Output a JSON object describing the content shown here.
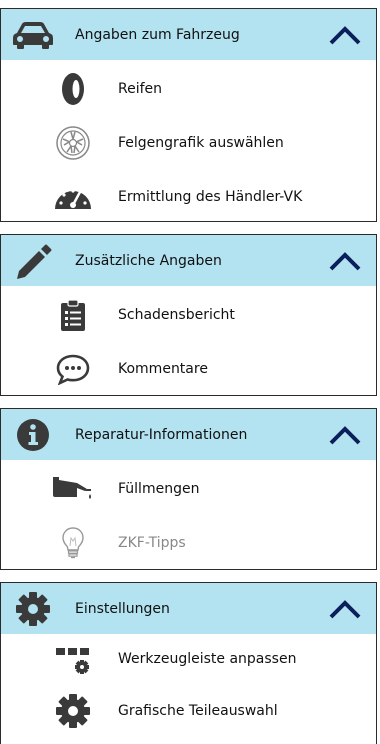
{
  "sections": [
    {
      "title": "Angaben zum Fahrzeug",
      "icon": "car-icon",
      "items": [
        {
          "label": "Reifen",
          "icon": "tire-icon"
        },
        {
          "label": "Felgengrafik auswählen",
          "icon": "rim-icon"
        },
        {
          "label": "Ermittlung des Händler-VK",
          "icon": "speedometer-icon"
        }
      ]
    },
    {
      "title": "Zusätzliche Angaben",
      "icon": "pencil-icon",
      "items": [
        {
          "label": "Schadensbericht",
          "icon": "clipboard-icon"
        },
        {
          "label": "Kommentare",
          "icon": "comment-icon"
        }
      ]
    },
    {
      "title": "Reparatur-Informationen",
      "icon": "info-icon",
      "items": [
        {
          "label": "Füllmengen",
          "icon": "oil-can-icon"
        },
        {
          "label": "ZKF-Tipps",
          "icon": "lightbulb-icon",
          "disabled": true
        }
      ]
    },
    {
      "title": "Einstellungen",
      "icon": "gear-icon",
      "items": [
        {
          "label": "Werkzeugleiste anpassen",
          "icon": "toolbar-settings-icon"
        },
        {
          "label": "Grafische Teileauswahl",
          "icon": "gear-icon"
        }
      ]
    }
  ],
  "colors": {
    "header_bg": "#b3e2f1",
    "icon_dark": "#3a3a3a",
    "chevron": "#0b1f5a",
    "disabled_text": "#888888"
  }
}
